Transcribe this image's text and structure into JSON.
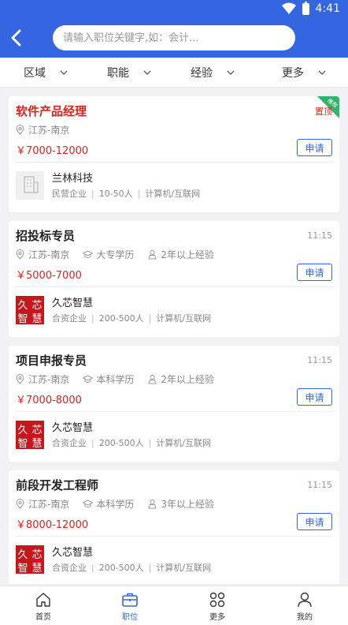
{
  "status": {
    "time": "4:41"
  },
  "search": {
    "placeholder": "请输入职位关键字,如：会计..."
  },
  "filters": [
    "区域",
    "职能",
    "经验",
    "更多"
  ],
  "jobs": [
    {
      "title": "软件产品经理",
      "time": "",
      "location": "江苏-南京",
      "education": "",
      "experience": "",
      "salary": "￥7000-12000",
      "apply": "申请",
      "pinned_label": "置顶",
      "pinned_badge": "推荐",
      "company": "兰林科技",
      "company_type": "民营企业",
      "size": "10-50人",
      "industry": "计算机/互联网",
      "logo_chars": []
    },
    {
      "title": "招投标专员",
      "time": "11:15",
      "location": "江苏-南京",
      "education": "大专学历",
      "experience": "2年以上经验",
      "salary": "￥5000-7000",
      "apply": "申请",
      "company": "久芯智慧",
      "company_type": "合资企业",
      "size": "200-500人",
      "industry": "计算机/互联网",
      "logo_chars": [
        "久",
        "芯",
        "智",
        "慧"
      ]
    },
    {
      "title": "项目申报专员",
      "time": "11:15",
      "location": "江苏-南京",
      "education": "本科学历",
      "experience": "2年以上经验",
      "salary": "￥7000-8000",
      "apply": "申请",
      "company": "久芯智慧",
      "company_type": "合资企业",
      "size": "200-500人",
      "industry": "计算机/互联网",
      "logo_chars": [
        "久",
        "芯",
        "智",
        "慧"
      ]
    },
    {
      "title": "前段开发工程师",
      "time": "11:15",
      "location": "江苏-南京",
      "education": "本科学历",
      "experience": "3年以上经验",
      "salary": "￥8000-12000",
      "apply": "申请",
      "company": "久芯智慧",
      "company_type": "合资企业",
      "size": "200-500人",
      "industry": "计算机/互联网",
      "logo_chars": [
        "久",
        "芯",
        "智",
        "慧"
      ]
    }
  ],
  "tabs": [
    "首页",
    "职位",
    "更多",
    "我的"
  ],
  "colors": {
    "primary": "#3366e0",
    "salary": "#e0211b",
    "badge": "#2fb56a",
    "logo": "#c8161d"
  }
}
